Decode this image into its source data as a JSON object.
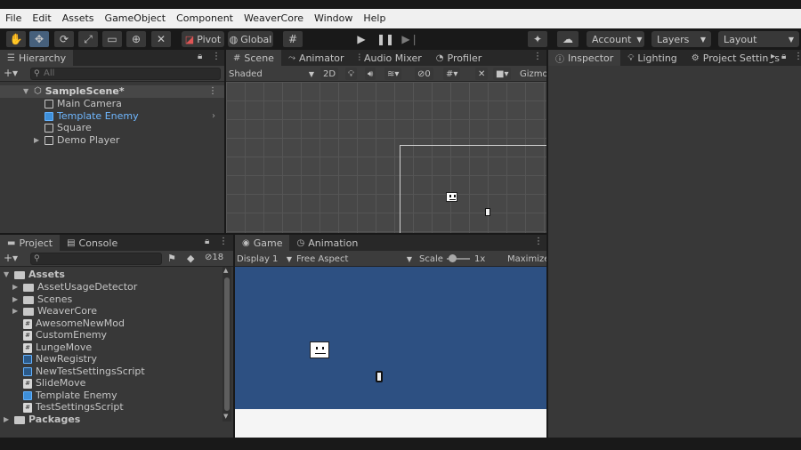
{
  "menu": [
    "File",
    "Edit",
    "Assets",
    "GameObject",
    "Component",
    "WeaverCore",
    "Window",
    "Help"
  ],
  "toolbar": {
    "pivot_label": "Pivot",
    "global_label": "Global",
    "account_label": "Account",
    "layers_label": "Layers",
    "layout_label": "Layout"
  },
  "hierarchy": {
    "tab_label": "Hierarchy",
    "search_placeholder": "All",
    "scene_name": "SampleScene*",
    "items": [
      {
        "label": "Main Camera"
      },
      {
        "label": "Template Enemy"
      },
      {
        "label": "Square"
      },
      {
        "label": "Demo Player"
      }
    ]
  },
  "scene": {
    "tabs": [
      "Scene",
      "Animator",
      "Audio Mixer",
      "Profiler"
    ],
    "shading": "Shaded",
    "two_d": "2D",
    "hidden_count": "0",
    "gizmos": "Gizmo"
  },
  "inspector": {
    "tabs": [
      "Inspector",
      "Lighting",
      "Project Settings"
    ]
  },
  "project": {
    "tabs": [
      "Project",
      "Console"
    ],
    "hidden_count": "18",
    "root": "Assets",
    "items": [
      {
        "label": "AssetUsageDetector",
        "type": "folder"
      },
      {
        "label": "Scenes",
        "type": "folder"
      },
      {
        "label": "WeaverCore",
        "type": "folder"
      },
      {
        "label": "AwesomeNewMod",
        "type": "script"
      },
      {
        "label": "CustomEnemy",
        "type": "script"
      },
      {
        "label": "LungeMove",
        "type": "script"
      },
      {
        "label": "NewRegistry",
        "type": "settings"
      },
      {
        "label": "NewTestSettingsScript",
        "type": "settings"
      },
      {
        "label": "SlideMove",
        "type": "script"
      },
      {
        "label": "Template Enemy",
        "type": "prefab"
      },
      {
        "label": "TestSettingsScript",
        "type": "script"
      }
    ],
    "packages": "Packages"
  },
  "game": {
    "tabs": [
      "Game",
      "Animation"
    ],
    "display": "Display 1",
    "aspect": "Free Aspect",
    "scale_label": "Scale",
    "scale_value": "1x",
    "maximize": "Maximize"
  },
  "colors": {
    "game_bg": "#2d5082",
    "selected_text": "#6fb7ff",
    "panel_bg": "#383838"
  }
}
